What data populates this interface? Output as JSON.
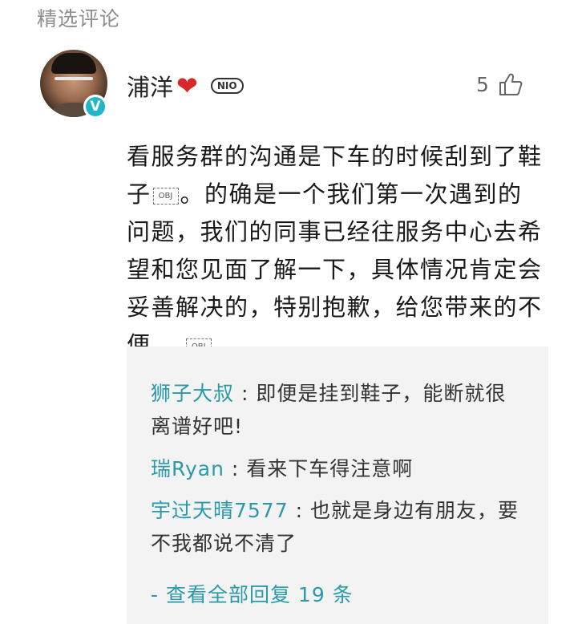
{
  "section": {
    "title": "精选评论"
  },
  "comment": {
    "author": "浦洋",
    "heart": "❤",
    "badge": "NIO",
    "verified_mark": "V",
    "likes": "5",
    "body_part1": "看服务群的沟通是下车的时候刮到了鞋子",
    "obj_label": "OBJ",
    "body_part2": "。的确是一个我们第一次遇到的问题，我们的同事已经往服务中心去希望和您见面了解一下，具体情况肯定会妥善解决的，特别抱歉，给您带来的不便。",
    "obj_label_2": "OBJ"
  },
  "replies": [
    {
      "author": "狮子大叔",
      "separator": " : ",
      "text": "即便是挂到鞋子，能断就很离谱好吧!"
    },
    {
      "author": "瑞Ryan",
      "separator": " : ",
      "text": "看来下车得注意啊"
    },
    {
      "author": "宇过天晴7577",
      "separator": " : ",
      "text": "也就是身边有朋友，要不我都说不清了"
    }
  ],
  "view_all": "- 查看全部回复 19 条",
  "icons": {
    "heart": "heart-icon",
    "like": "thumbs-up-icon",
    "verified": "verified-badge-icon"
  },
  "colors": {
    "accent": "#2a9aaa",
    "heart": "#d62828",
    "verified": "#20b8c8",
    "reply_bg": "#f3f3f3"
  }
}
